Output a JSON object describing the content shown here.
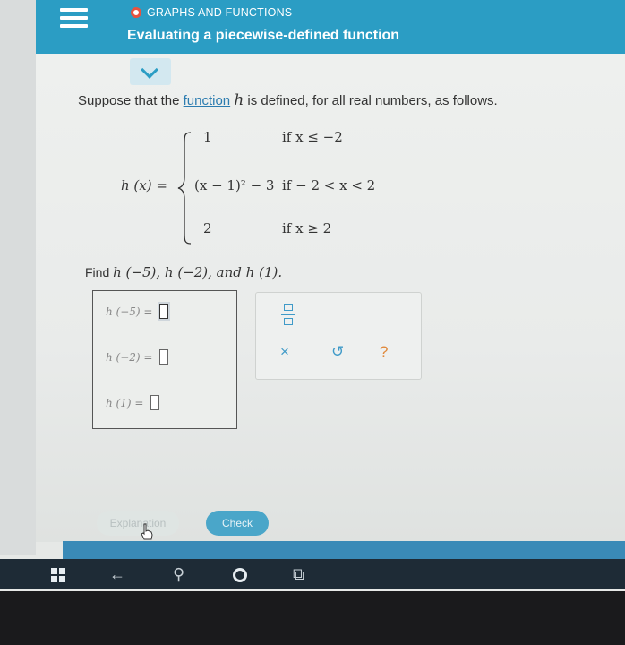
{
  "header": {
    "topic": "GRAPHS AND FUNCTIONS",
    "title": "Evaluating a piecewise-defined function"
  },
  "problem": {
    "prompt_start": "Suppose that the ",
    "prompt_link": "function",
    "prompt_var": "h",
    "prompt_end": " is defined, for all real numbers, as follows.",
    "lhs": "h (x) =",
    "cases": [
      {
        "value": "1",
        "condition": "if x ≤ −2"
      },
      {
        "value": "(x − 1)² − 3",
        "condition": "if − 2 < x < 2"
      },
      {
        "value": "2",
        "condition": "if x ≥ 2"
      }
    ],
    "find_label": "Find ",
    "find_expr": "h (−5), h (−2), and h (1)."
  },
  "answers": [
    {
      "label": "h (−5) =",
      "value": ""
    },
    {
      "label": "h (−2) =",
      "value": ""
    },
    {
      "label": "h (1) =",
      "value": ""
    }
  ],
  "tools": {
    "fraction_icon": "fraction-icon",
    "clear": "×",
    "undo": "↺",
    "help": "?"
  },
  "buttons": {
    "explanation": "Explanation",
    "check": "Check"
  },
  "taskbar": {
    "back": "←",
    "search": "⚲",
    "task_view": "⧉"
  },
  "colors": {
    "header": "#2b9dc4",
    "accent": "#2c7cb0",
    "topic_dot": "#e8523f"
  }
}
